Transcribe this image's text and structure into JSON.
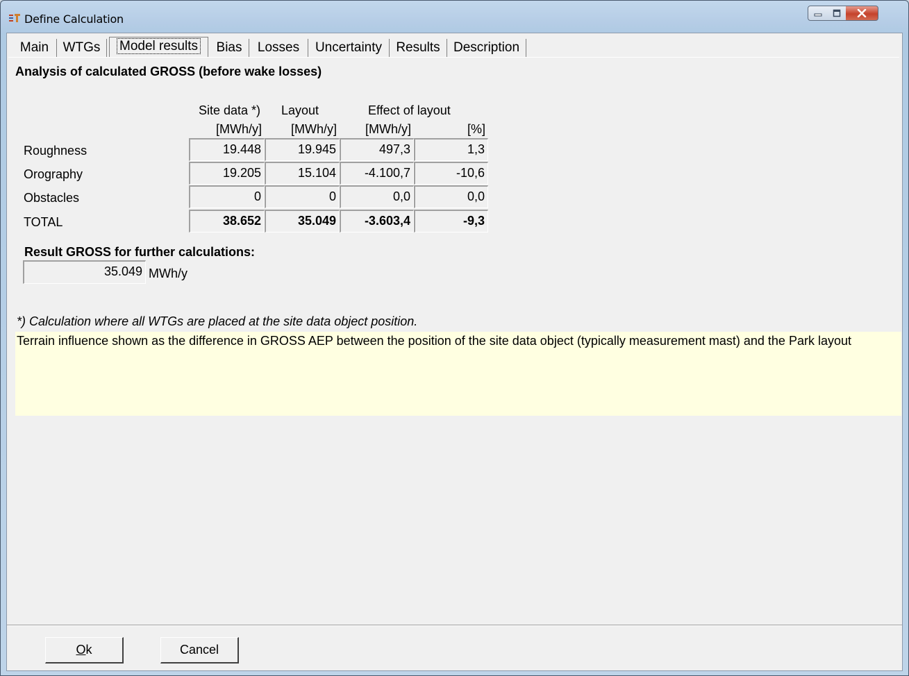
{
  "window": {
    "title": "Define Calculation",
    "icon": "app-icon"
  },
  "caption_buttons": {
    "minimize": "minimize-icon",
    "maximize": "maximize-icon",
    "close": "close-icon"
  },
  "tabs": [
    {
      "label": "Main",
      "active": false
    },
    {
      "label": "WTGs",
      "active": false
    },
    {
      "label": "Model results",
      "active": true
    },
    {
      "label": "Bias",
      "active": false
    },
    {
      "label": "Losses",
      "active": false
    },
    {
      "label": "Uncertainty",
      "active": false
    },
    {
      "label": "Results",
      "active": false
    },
    {
      "label": "Description",
      "active": false
    }
  ],
  "panel": {
    "heading": "Analysis of calculated GROSS (before wake losses)",
    "table": {
      "col_headers": [
        "Site data *)",
        "Layout",
        "Effect of layout"
      ],
      "units": [
        "[MWh/y]",
        "[MWh/y]",
        "[MWh/y]",
        "[%]"
      ],
      "rows": [
        {
          "label": "Roughness",
          "values": [
            "19.448",
            "19.945",
            "497,3",
            "1,3"
          ]
        },
        {
          "label": "Orography",
          "values": [
            "19.205",
            "15.104",
            "-4.100,7",
            "-10,6"
          ]
        },
        {
          "label": "Obstacles",
          "values": [
            "0",
            "0",
            "0,0",
            "0,0"
          ]
        },
        {
          "label": "TOTAL",
          "values": [
            "38.652",
            "35.049",
            "-3.603,4",
            "-9,3"
          ],
          "bold": true
        }
      ]
    },
    "result_label": "Result GROSS for further calculations:",
    "result_value": "35.049",
    "result_unit": "MWh/y",
    "footnote": "*) Calculation where all WTGs are placed at the site data object position.",
    "description": "Terrain influence shown as the difference in GROSS AEP between the position of the site data object (typically measurement mast) and the Park layout"
  },
  "buttons": {
    "ok_rest": "k",
    "ok_mnemonic": "O",
    "cancel": "Cancel"
  }
}
